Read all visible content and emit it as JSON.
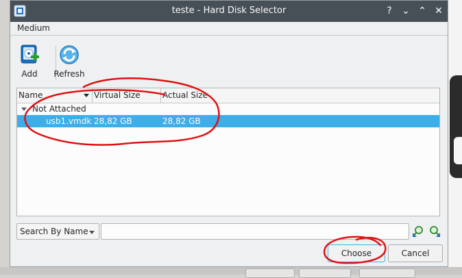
{
  "window": {
    "title": "teste - Hard Disk Selector",
    "controls": {
      "help": "?",
      "minimize": "⌄",
      "maximize": "⌃",
      "close": "✕"
    }
  },
  "tabs": {
    "medium": "Medium"
  },
  "toolbar": {
    "add_label": "Add",
    "refresh_label": "Refresh"
  },
  "table": {
    "columns": [
      "Name",
      "Virtual Size",
      "Actual Size"
    ],
    "group_label": "Not Attached",
    "rows": [
      {
        "name": "usb1.vmdk",
        "virtual_size": "28,82 GB",
        "actual_size": "28,82 GB",
        "selected": true
      }
    ]
  },
  "search": {
    "mode": "Search By Name",
    "value": ""
  },
  "buttons": {
    "choose": "Choose",
    "cancel": "Cancel"
  },
  "colors": {
    "titlebar": "#475057",
    "selection": "#3daee9",
    "annotation": "#e01010"
  },
  "icons": [
    "app-icon",
    "add-disk-icon",
    "refresh-icon",
    "search-backward-icon",
    "search-forward-icon"
  ]
}
